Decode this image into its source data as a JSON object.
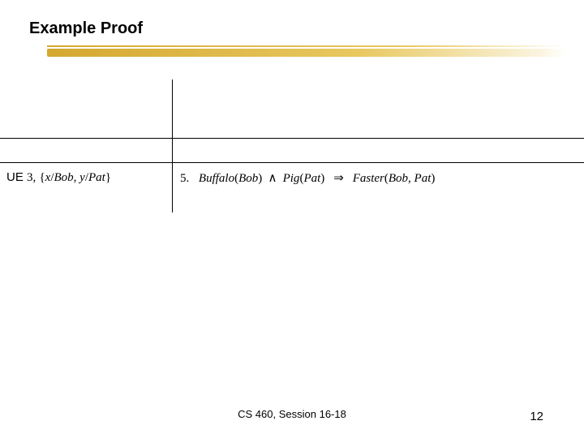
{
  "title": "Example Proof",
  "table": {
    "row": {
      "rule": "UE",
      "rule_ref": "3,",
      "subst_open": "{",
      "subst_x_var": "x",
      "subst_slash1": "/",
      "subst_x_val": "Bob",
      "subst_comma": ",",
      "subst_y_var": "y",
      "subst_slash2": "/",
      "subst_y_val": "Pat",
      "subst_close": "}",
      "step_num": "5.",
      "pred1": "Buffalo",
      "pred1_lp": "(",
      "pred1_arg": "Bob",
      "pred1_rp": ")",
      "and": "∧",
      "pred2": "Pig",
      "pred2_lp": "(",
      "pred2_arg": "Pat",
      "pred2_rp": ")",
      "implies": "⇒",
      "pred3": "Faster",
      "pred3_lp": "(",
      "pred3_arg1": "Bob",
      "pred3_comma": ",",
      "pred3_arg2": "Pat",
      "pred3_rp": ")"
    }
  },
  "footer": {
    "center": "CS 460,  Session 16-18",
    "page": "12"
  }
}
